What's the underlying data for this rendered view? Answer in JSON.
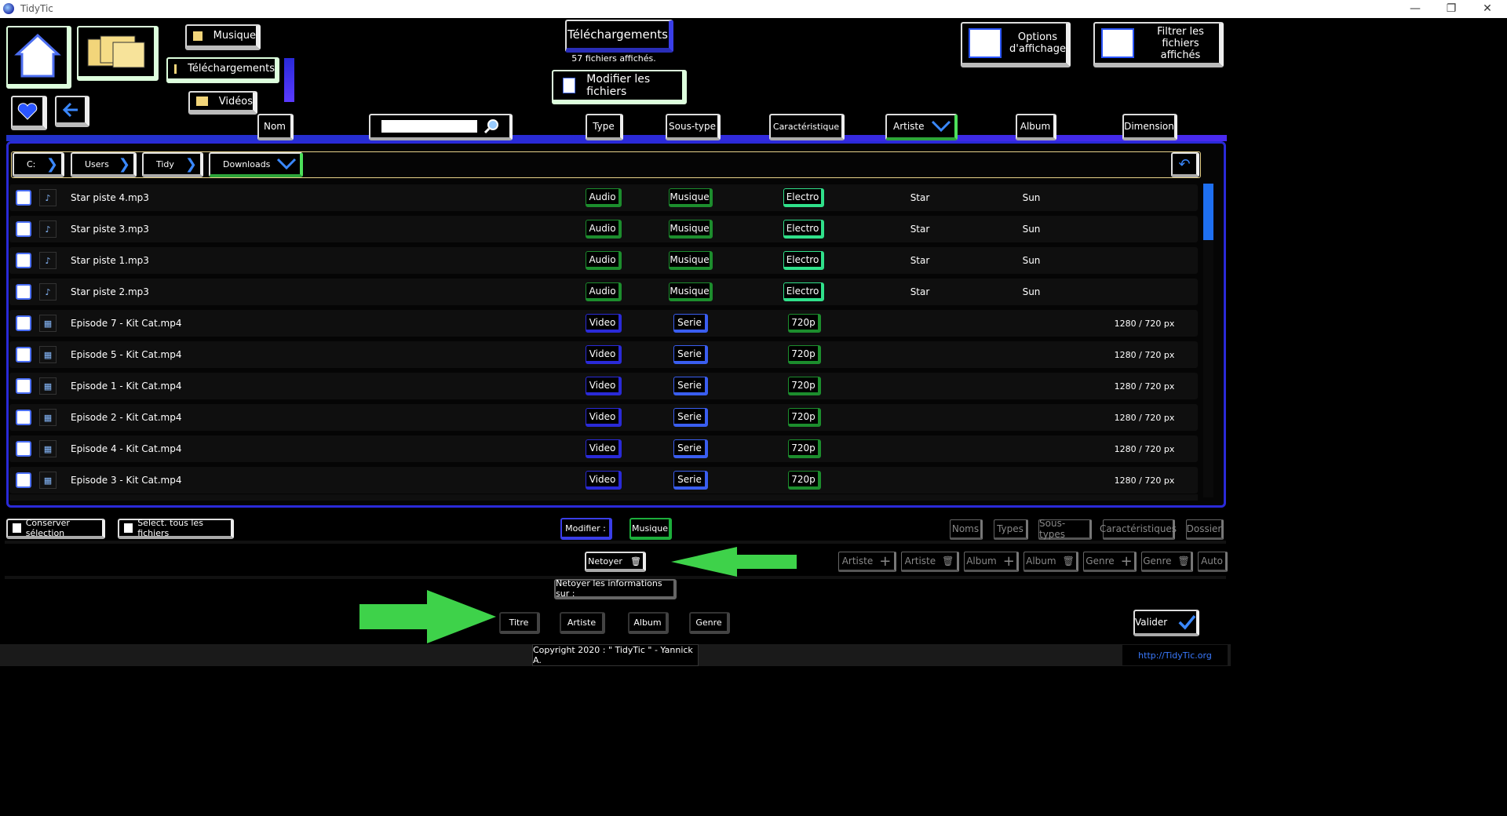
{
  "window": {
    "title": "TidyTic"
  },
  "nav": {
    "musique": "Musique",
    "telechargements": "Téléchargements",
    "videos": "Vidéos"
  },
  "header": {
    "title": "Téléchargements",
    "count": "57 fichiers affichés.",
    "modify_files": "Modifier les fichiers",
    "options_line1": "Options",
    "options_line2": "d'affichage",
    "filter_line1": "Filtrer les",
    "filter_line2": "fichiers affichés"
  },
  "columns": {
    "nom": "Nom",
    "type": "Type",
    "soustype": "Sous-type",
    "caracteristique": "Caractéristique",
    "artiste": "Artiste",
    "album": "Album",
    "dimension": "Dimension"
  },
  "search": {
    "value": ""
  },
  "breadcrumb": [
    "C:",
    "Users",
    "Tidy",
    "Downloads"
  ],
  "files": [
    {
      "name": "Star piste 4.mp3",
      "type": "Audio",
      "subtype": "Musique",
      "carac": "Electro",
      "artist": "Star",
      "album": "Sun",
      "dimension": "",
      "kind": "audio"
    },
    {
      "name": "Star piste 3.mp3",
      "type": "Audio",
      "subtype": "Musique",
      "carac": "Electro",
      "artist": "Star",
      "album": "Sun",
      "dimension": "",
      "kind": "audio"
    },
    {
      "name": "Star piste 1.mp3",
      "type": "Audio",
      "subtype": "Musique",
      "carac": "Electro",
      "artist": "Star",
      "album": "Sun",
      "dimension": "",
      "kind": "audio"
    },
    {
      "name": "Star piste 2.mp3",
      "type": "Audio",
      "subtype": "Musique",
      "carac": "Electro",
      "artist": "Star",
      "album": "Sun",
      "dimension": "",
      "kind": "audio"
    },
    {
      "name": "Episode 7 - Kit Cat.mp4",
      "type": "Video",
      "subtype": "Serie",
      "carac": "720p",
      "artist": "",
      "album": "",
      "dimension": "1280 / 720 px",
      "kind": "video"
    },
    {
      "name": "Episode 5 - Kit Cat.mp4",
      "type": "Video",
      "subtype": "Serie",
      "carac": "720p",
      "artist": "",
      "album": "",
      "dimension": "1280 / 720 px",
      "kind": "video"
    },
    {
      "name": "Episode 1 - Kit Cat.mp4",
      "type": "Video",
      "subtype": "Serie",
      "carac": "720p",
      "artist": "",
      "album": "",
      "dimension": "1280 / 720 px",
      "kind": "video"
    },
    {
      "name": "Episode 2 - Kit Cat.mp4",
      "type": "Video",
      "subtype": "Serie",
      "carac": "720p",
      "artist": "",
      "album": "",
      "dimension": "1280 / 720 px",
      "kind": "video"
    },
    {
      "name": "Episode 4 - Kit Cat.mp4",
      "type": "Video",
      "subtype": "Serie",
      "carac": "720p",
      "artist": "",
      "album": "",
      "dimension": "1280 / 720 px",
      "kind": "video"
    },
    {
      "name": "Episode 3 - Kit Cat.mp4",
      "type": "Video",
      "subtype": "Serie",
      "carac": "720p",
      "artist": "",
      "album": "",
      "dimension": "1280 / 720 px",
      "kind": "video"
    }
  ],
  "actions": {
    "keep_selection": "Conserver sélection",
    "select_all": "Select. tous les fichiers",
    "modifier": "Modifier :",
    "musique": "Musique",
    "noms": "Noms",
    "types": "Types",
    "soustypes": "Sous-types",
    "caracteristiques": "Caractéristiques",
    "dossier": "Dossier",
    "netoyer": "Netoyer",
    "artiste_add": "Artiste",
    "artiste_del": "Artiste",
    "album_add": "Album",
    "album_del": "Album",
    "genre_add": "Genre",
    "genre_del": "Genre",
    "auto": "Auto",
    "netoyer_info": "Netoyer les informations sur :",
    "titre": "Titre",
    "artiste": "Artiste",
    "album": "Album",
    "genre": "Genre",
    "valider": "Valider"
  },
  "footer": {
    "copyright": "Copyright 2020 : \" TidyTic \" - Yannick A.",
    "url": "http://TidyTic.org"
  },
  "colors": {
    "accent_blue": "#2a2ad8",
    "accent_green": "#3ddc4f",
    "arrow_green": "#3ed24a"
  }
}
